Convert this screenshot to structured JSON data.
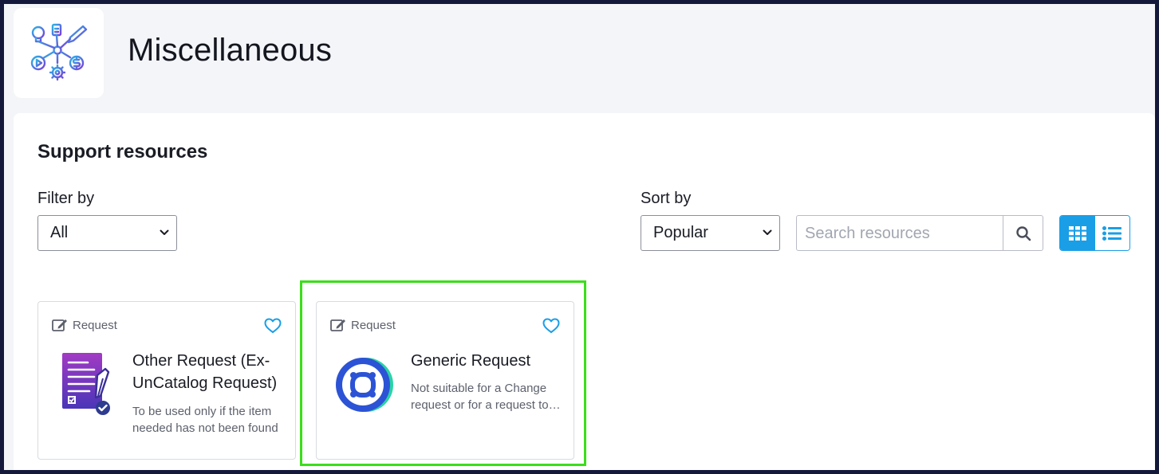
{
  "header": {
    "title": "Miscellaneous",
    "logo_icon": "miscellaneous-services-icon"
  },
  "section": {
    "title": "Support resources"
  },
  "filter": {
    "label": "Filter by",
    "selected": "All"
  },
  "sort": {
    "label": "Sort by",
    "selected": "Popular"
  },
  "search": {
    "placeholder": "Search resources",
    "icon": "search-icon"
  },
  "view_toggle": {
    "active": "grid",
    "grid_icon": "grid-view-icon",
    "list_icon": "list-view-icon"
  },
  "cards": [
    {
      "type_label": "Request",
      "type_icon": "edit-form-icon",
      "title": "Other Request (Ex-UnCatalog Request)",
      "description": "To be used only if the item needed has not been found",
      "icon": "checklist-document-icon",
      "favorite_icon": "heart-outline-icon"
    },
    {
      "type_label": "Request",
      "type_icon": "edit-form-icon",
      "title": "Generic Request",
      "description": "Not suitable for a Change request or for a request to…",
      "icon": "generic-request-ring-icon",
      "favorite_icon": "heart-outline-icon"
    }
  ],
  "colors": {
    "accent": "#1a9ee6",
    "highlight": "#3ade1a",
    "page_background": "#f4f5f8",
    "outer_border": "#14183a"
  }
}
